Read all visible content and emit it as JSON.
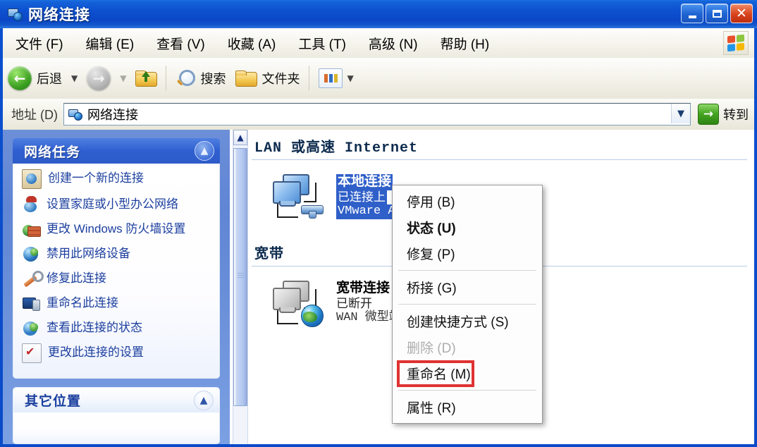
{
  "window": {
    "title": "网络连接",
    "buttons": {
      "minimize": "最小化",
      "maximize": "最大化",
      "close": "关闭"
    }
  },
  "menubar": {
    "items": [
      {
        "label": "文件 (F)"
      },
      {
        "label": "编辑 (E)"
      },
      {
        "label": "查看 (V)"
      },
      {
        "label": "收藏 (A)"
      },
      {
        "label": "工具 (T)"
      },
      {
        "label": "高级 (N)"
      },
      {
        "label": "帮助 (H)"
      }
    ],
    "logo": "windows-flag"
  },
  "toolbar": {
    "back": "后退",
    "forward": "",
    "up": "",
    "search": "搜索",
    "folders": "文件夹",
    "views": ""
  },
  "address": {
    "label": "地址 (D)",
    "value": "网络连接",
    "placeholder": "网络连接",
    "go": "转到"
  },
  "sidebar": {
    "panels": [
      {
        "title": "网络任务",
        "collapse": "▲",
        "items": [
          {
            "label": "创建一个新的连接",
            "icon": "new-connection-icon"
          },
          {
            "label": "设置家庭或小型办公网络",
            "icon": "home-network-icon"
          },
          {
            "label": "更改 Windows 防火墙设置",
            "icon": "firewall-icon"
          },
          {
            "label": "禁用此网络设备",
            "icon": "disable-device-icon"
          },
          {
            "label": "修复此连接",
            "icon": "repair-icon"
          },
          {
            "label": "重命名此连接",
            "icon": "rename-icon"
          },
          {
            "label": "查看此连接的状态",
            "icon": "status-icon"
          },
          {
            "label": "更改此连接的设置",
            "icon": "settings-icon"
          }
        ]
      },
      {
        "title": "其它位置",
        "collapse": "▲",
        "items": []
      }
    ]
  },
  "content": {
    "groups": [
      {
        "header": "LAN 或高速 Internet",
        "items": [
          {
            "name": "本地连接",
            "status": "已连接上",
            "device": "VMware Acc",
            "selected": true,
            "icon": "lan-connection-icon"
          }
        ]
      },
      {
        "header": "宽带",
        "items": [
          {
            "name": "宽带连接",
            "status": "已断开",
            "device": "WAN 微型端",
            "selected": false,
            "icon": "broadband-connection-icon"
          }
        ]
      }
    ]
  },
  "context_menu": {
    "items": [
      {
        "label": "停用 (B)",
        "bold": false,
        "disabled": false,
        "separator_after": false
      },
      {
        "label": "状态 (U)",
        "bold": true,
        "disabled": false,
        "separator_after": false
      },
      {
        "label": "修复 (P)",
        "bold": false,
        "disabled": false,
        "separator_after": true
      },
      {
        "label": "桥接 (G)",
        "bold": false,
        "disabled": false,
        "separator_after": true
      },
      {
        "label": "创建快捷方式 (S)",
        "bold": false,
        "disabled": false,
        "separator_after": false
      },
      {
        "label": "删除 (D)",
        "bold": false,
        "disabled": true,
        "separator_after": false
      },
      {
        "label": "重命名 (M)",
        "bold": false,
        "disabled": false,
        "separator_after": true
      },
      {
        "label": "属性 (R)",
        "bold": false,
        "disabled": false,
        "separator_after": false
      }
    ],
    "highlight_label": "属性 (R)",
    "highlight_color": "#e03232"
  },
  "scrollbar": {
    "up_arrow": "▲"
  },
  "colors": {
    "titlebar_blue": "#0b50d0",
    "panel_header_blue": "#2f5fd0",
    "selection_blue": "#2f5fc8",
    "task_link": "#1c3f9e",
    "annotation_red": "#e03232"
  }
}
